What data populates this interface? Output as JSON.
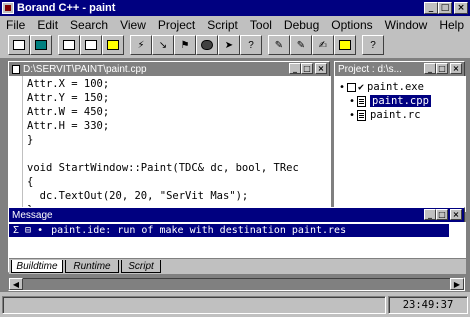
{
  "app": {
    "title": "Borand C++ - paint"
  },
  "menu": [
    {
      "label": "File"
    },
    {
      "label": "Edit"
    },
    {
      "label": "Search"
    },
    {
      "label": "View"
    },
    {
      "label": "Project"
    },
    {
      "label": "Script"
    },
    {
      "label": "Tool"
    },
    {
      "label": "Debug"
    },
    {
      "label": "Options"
    },
    {
      "label": "Window"
    },
    {
      "label": "Help"
    }
  ],
  "toolbar": {
    "buttons": [
      "open-icon",
      "save-icon",
      "print-icon",
      "copy-icon",
      "paste-icon",
      "run-icon",
      "step-icon",
      "trace-icon",
      "breakpoint-icon",
      "stop-icon",
      "help-icon"
    ]
  },
  "editor": {
    "title": "D:\\SERVIT\\PAINT\\paint.cpp",
    "lines": [
      "Attr.X = 100;",
      "Attr.Y = 150;",
      "Attr.W = 450;",
      "Attr.H = 330;",
      "}",
      "",
      "void StartWindow::Paint(TDC& dc, bool, TRec",
      "{",
      "  dc.TextOut(20, 20, \"SerVit Mas\");",
      "}"
    ]
  },
  "project": {
    "title": "Project : d:\\s...",
    "items": [
      {
        "label": "paint.exe",
        "selected": false
      },
      {
        "label": "paint.cpp",
        "selected": true
      },
      {
        "label": "paint.rc",
        "selected": false
      }
    ]
  },
  "message": {
    "title": "Message",
    "text": "paint.ide: run of make with destination paint.res",
    "tabs": [
      "Buildtime",
      "Runtime",
      "Script"
    ]
  },
  "status": {
    "time": "23:49:37"
  },
  "colors": {
    "title_active": "#000080",
    "face": "#c0c0c0",
    "mdi_bg": "#808080"
  }
}
